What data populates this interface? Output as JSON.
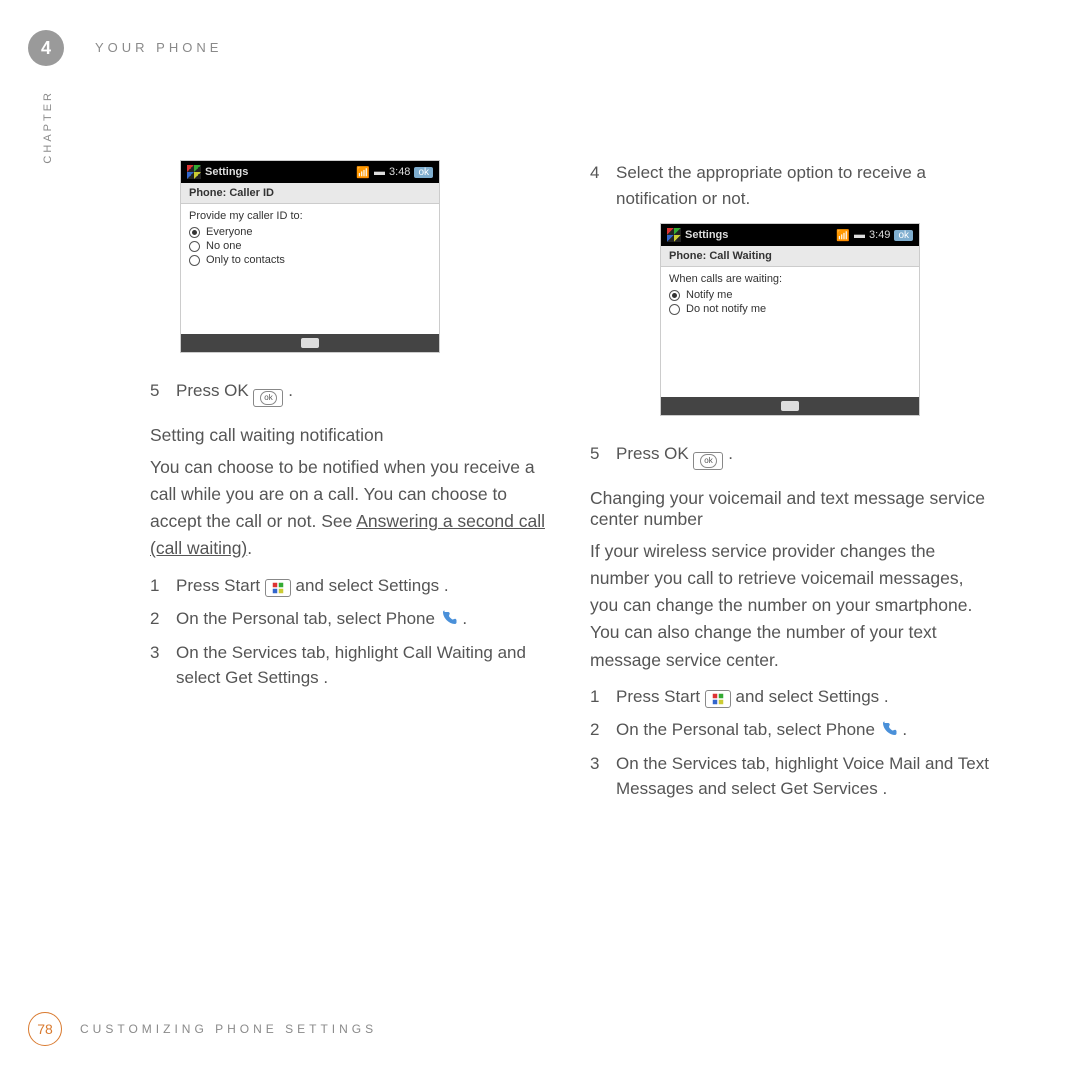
{
  "header": {
    "chapter_number": "4",
    "running_head": "YOUR PHONE",
    "vertical_label": "CHAPTER"
  },
  "left": {
    "screenshot": {
      "status_title": "Settings",
      "time": "3:48",
      "ok": "ok",
      "subtitle": "Phone: Caller ID",
      "prompt": "Provide my caller ID to:",
      "options": [
        "Everyone",
        "No one",
        "Only to contacts"
      ]
    },
    "step5_a": "Press OK",
    "step5_b": ".",
    "subhead": "Setting call waiting notification",
    "para_a": "You can choose to be notified when you receive a call while you are on a call. You can choose to accept the call or not. See ",
    "para_link": "Answering a second call (call waiting)",
    "para_c": ".",
    "s1_a": "Press Start ",
    "s1_b": " and select Settings .",
    "s2_a": "On the Personal tab, select Phone ",
    "s2_b": " .",
    "s3": "On the Services tab, highlight Call Waiting  and select Get Settings .",
    "n1": "1",
    "n2": "2",
    "n3": "3",
    "n5": "5"
  },
  "right": {
    "step4": "Select the appropriate option to receive a notification or not.",
    "screenshot": {
      "status_title": "Settings",
      "time": "3:49",
      "ok": "ok",
      "subtitle": "Phone: Call Waiting",
      "prompt": "When calls are waiting:",
      "options": [
        "Notify me",
        "Do not notify me"
      ]
    },
    "step5_a": "Press OK",
    "step5_b": ".",
    "subhead": "Changing your voicemail and text message service center number",
    "para": "If your wireless service provider changes the number you call to retrieve voicemail messages, you can change the number on your smartphone. You can also change the number of your text message service center.",
    "s1_a": "Press Start ",
    "s1_b": " and select Settings .",
    "s2_a": "On the Personal tab, select Phone ",
    "s2_b": " .",
    "s3": "On the Services tab, highlight Voice Mail and Text Messages   and select Get Services .",
    "n1": "1",
    "n2": "2",
    "n3": "3",
    "n4": "4",
    "n5": "5"
  },
  "footer": {
    "page": "78",
    "section": "CUSTOMIZING PHONE SETTINGS"
  }
}
